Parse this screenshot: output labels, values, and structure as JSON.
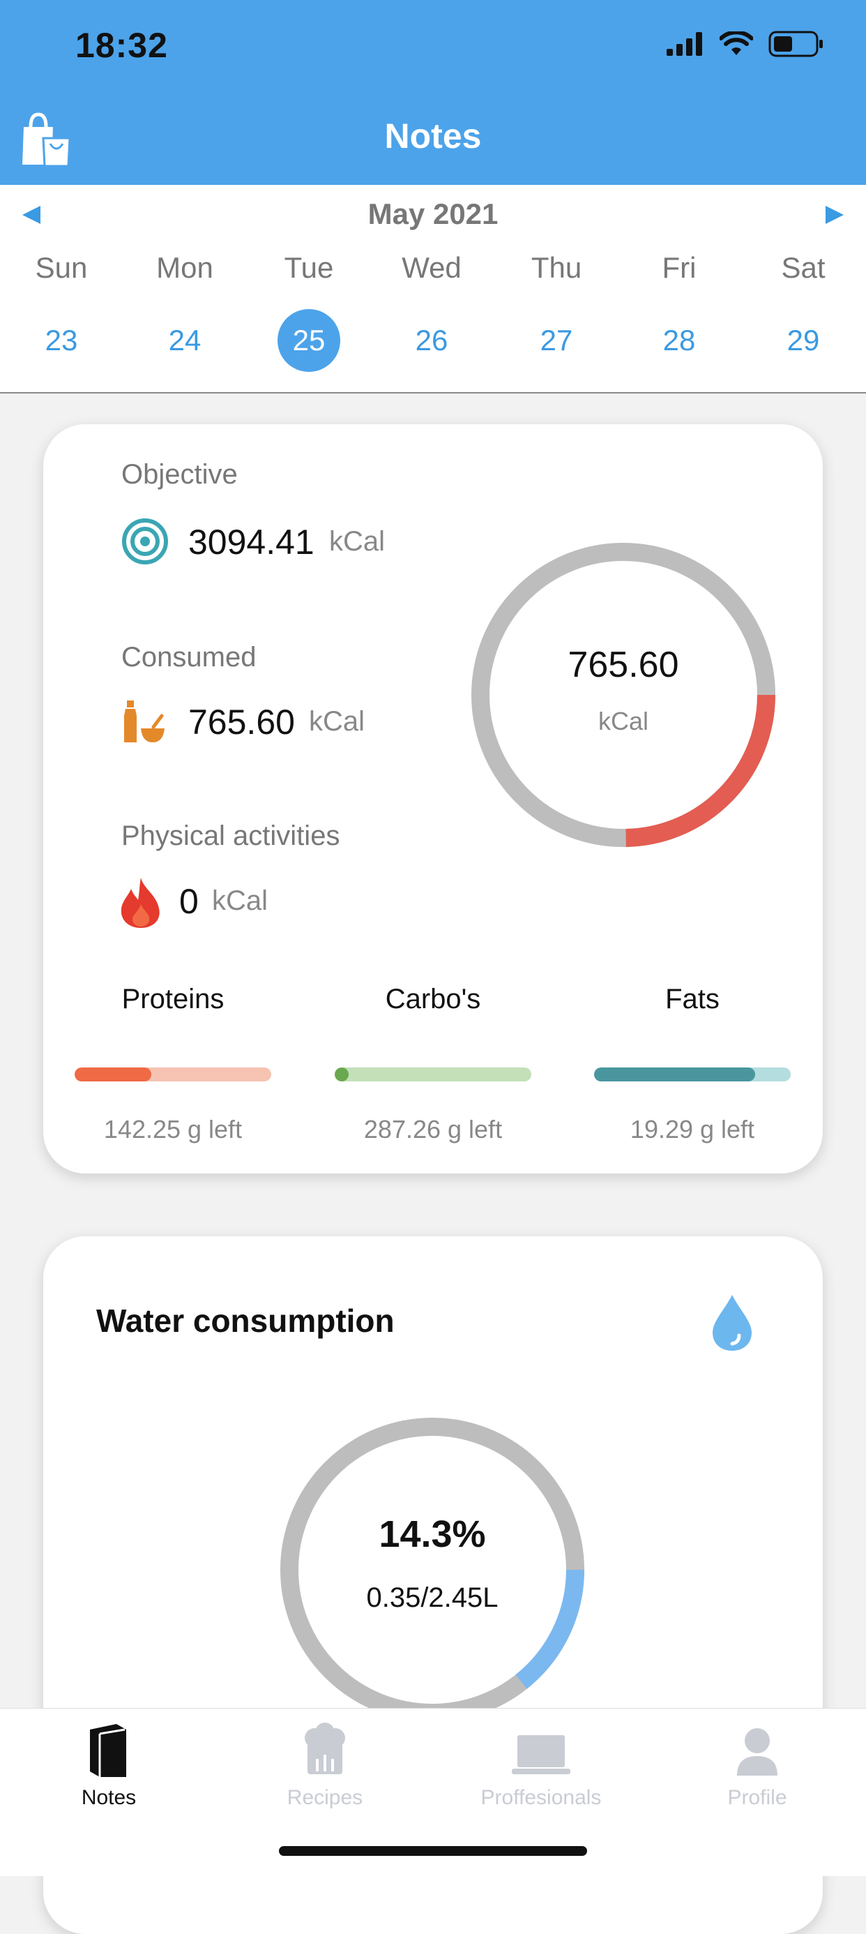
{
  "status": {
    "time": "18:32"
  },
  "header": {
    "title": "Notes"
  },
  "calendar": {
    "month": "May 2021",
    "weekdays": [
      "Sun",
      "Mon",
      "Tue",
      "Wed",
      "Thu",
      "Fri",
      "Sat"
    ],
    "days": [
      "23",
      "24",
      "25",
      "26",
      "27",
      "28",
      "29"
    ],
    "selected_day": "25"
  },
  "summary": {
    "objective_label": "Objective",
    "objective_value": "3094.41",
    "consumed_label": "Consumed",
    "consumed_value": "765.60",
    "activities_label": "Physical activities",
    "activities_value": "0",
    "unit": "kCal",
    "ring_value": "765.60",
    "ring_unit": "kCal",
    "ring_fraction": 0.247
  },
  "macros": [
    {
      "name": "Proteins",
      "left": "142.25 g left",
      "progress": 0.39,
      "color": "#ef6a45",
      "track": "#f6c3b2"
    },
    {
      "name": "Carbo's",
      "left": "287.26 g left",
      "progress": 0.07,
      "color": "#6aa84f",
      "track": "#c3e0b9"
    },
    {
      "name": "Fats",
      "left": "19.29 g left",
      "progress": 0.82,
      "color": "#4a969f",
      "track": "#b4dde0"
    }
  ],
  "water": {
    "title": "Water consumption",
    "percent": "14.3%",
    "amount": "0.35/2.45L",
    "fraction": 0.143
  },
  "tabs": [
    {
      "label": "Notes",
      "icon": "book-icon",
      "active": true
    },
    {
      "label": "Recipes",
      "icon": "chef-hat-icon",
      "active": false
    },
    {
      "label": "Proffesionals",
      "icon": "laptop-icon",
      "active": false
    },
    {
      "label": "Profile",
      "icon": "person-icon",
      "active": false
    }
  ],
  "colors": {
    "accent": "#4ca3ea",
    "ring_track": "#bdbdbd",
    "ring_progress": "#e35d52",
    "water_progress": "#7bb8f0"
  }
}
